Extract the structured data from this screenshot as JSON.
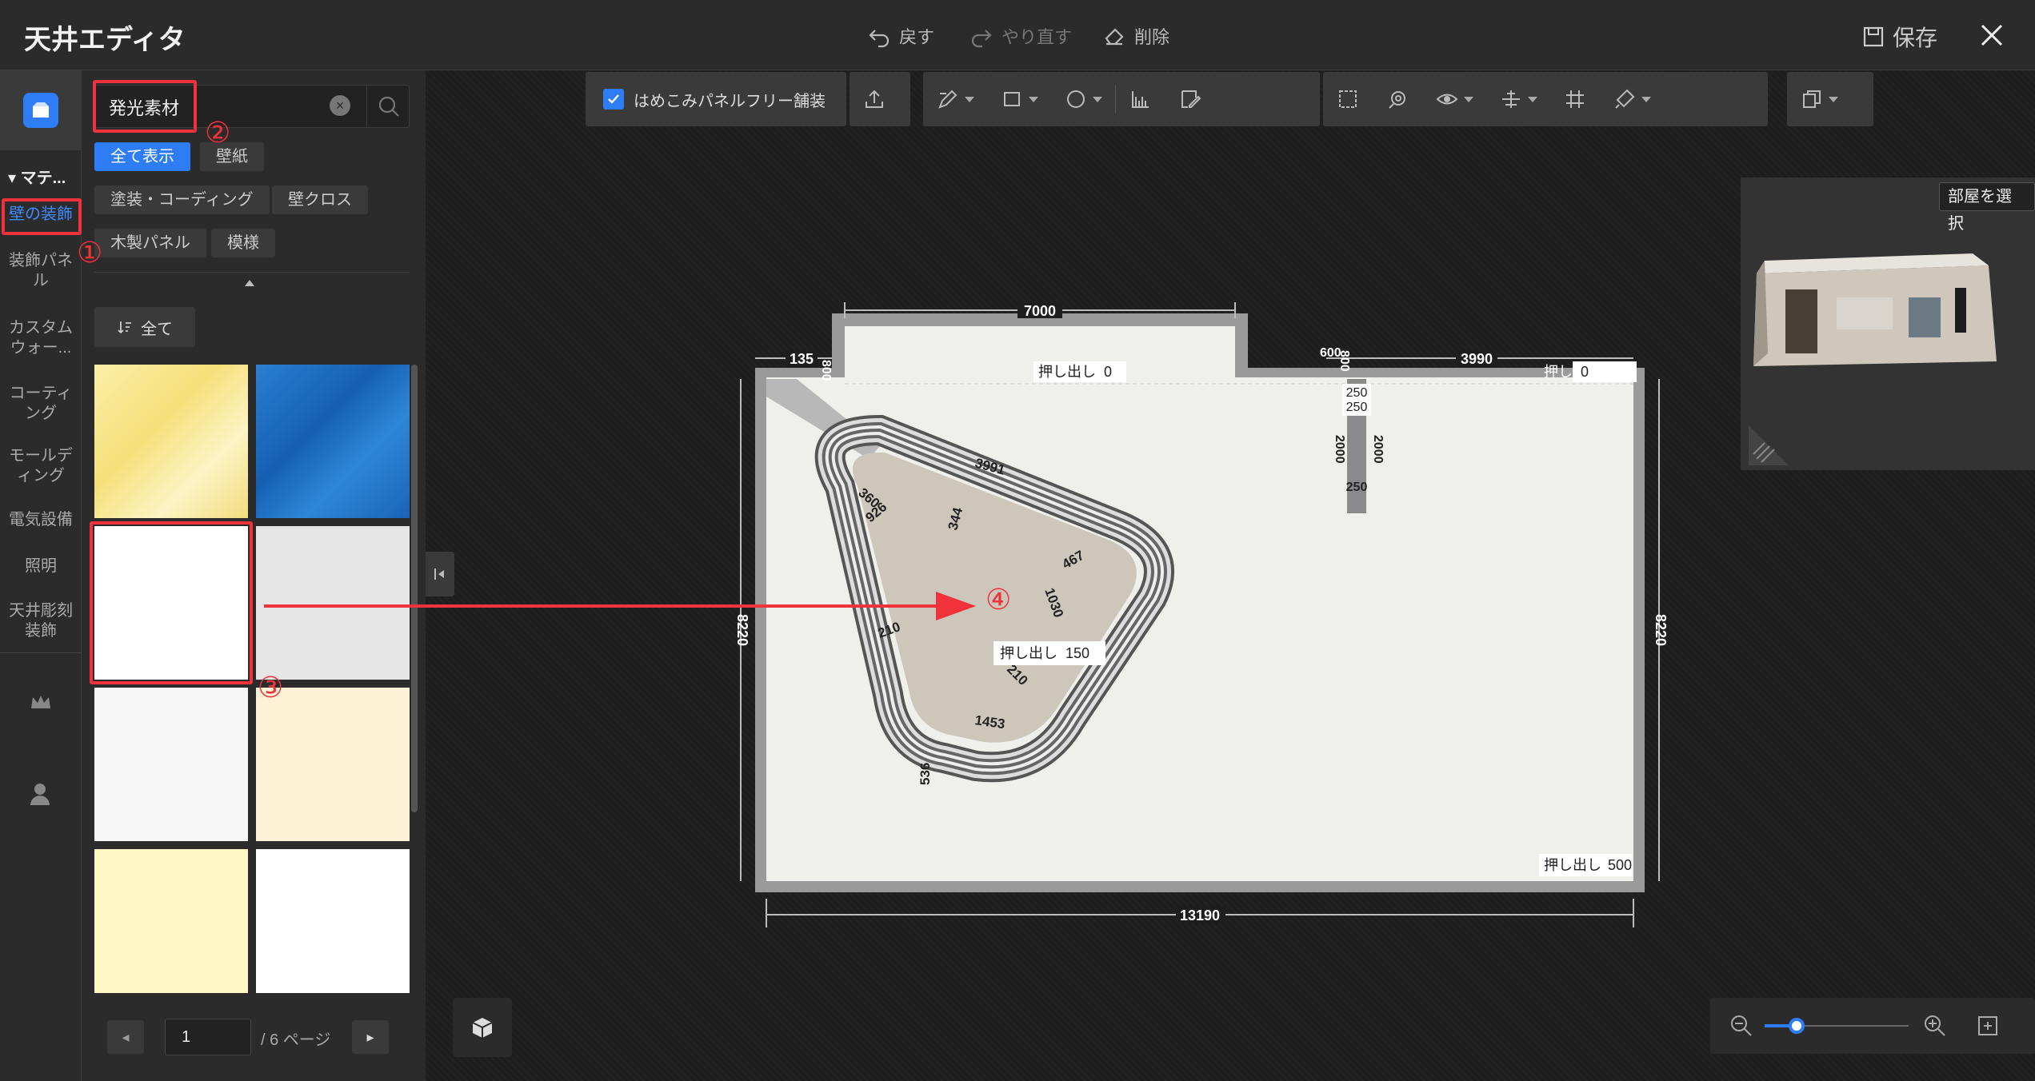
{
  "app": {
    "title": "天井エディタ"
  },
  "topbar": {
    "undo_label": "戻す",
    "redo_label": "やり直す",
    "delete_label": "削除",
    "save_label": "保存"
  },
  "leftnav": {
    "group_label": "マテ...",
    "items": [
      {
        "label": "壁の装飾"
      },
      {
        "label": "装飾パネル"
      },
      {
        "label": "カスタムウォー..."
      },
      {
        "label": "コーティング"
      },
      {
        "label": "モールディング"
      },
      {
        "label": "電気設備"
      },
      {
        "label": "照明"
      },
      {
        "label": "天井彫刻装飾"
      }
    ]
  },
  "panel": {
    "search_value": "発光素材",
    "chips": [
      "全て表示",
      "壁紙",
      "塗装・コーディング",
      "壁クロス",
      "木製パネル",
      "模様"
    ],
    "sort_label": "全て",
    "tiles": [
      {
        "name": "yellow-marble",
        "color": "#f5e28a"
      },
      {
        "name": "blue-marble",
        "color": "#1f6fc6"
      },
      {
        "name": "white",
        "color": "#ffffff"
      },
      {
        "name": "light-gray",
        "color": "#e6e6e6"
      },
      {
        "name": "off-white",
        "color": "#f7f7f7"
      },
      {
        "name": "cream",
        "color": "#fdf1d6"
      },
      {
        "name": "pale-yellow",
        "color": "#fdf8c6"
      },
      {
        "name": "white-2",
        "color": "#ffffff"
      }
    ],
    "pager": {
      "current": "1",
      "total": "/ 6 ページ"
    }
  },
  "toolbar": {
    "checkbox_label": "はめこみパネルフリー舗装"
  },
  "minimap": {
    "select_room_label": "部屋を選択"
  },
  "annotations": {
    "n1": "①",
    "n2": "②",
    "n3": "③",
    "n4": "④"
  },
  "plan": {
    "dims": {
      "top": "7000",
      "top_right": "3990",
      "left_small": "135",
      "v_small": "800",
      "v_small2": "800",
      "c600": "600",
      "c250a": "250",
      "c250b": "250",
      "c250c": "250",
      "c2000a": "2000",
      "c2000b": "2000",
      "left": "8220",
      "right": "8220",
      "bottom": "13190",
      "d360": "360",
      "d926": "926",
      "d3991": "3991",
      "d344": "344",
      "d467": "467",
      "d1030": "1030",
      "d210a": "210",
      "d210b": "210",
      "d1453": "1453",
      "d536": "536"
    },
    "extrude": [
      {
        "label": "押し出し",
        "value": "0"
      },
      {
        "label": "押し出し",
        "value": "0"
      },
      {
        "label": "押し出し",
        "value": "150"
      },
      {
        "label": "押し出し",
        "value": "500"
      }
    ]
  },
  "colors": {
    "accent": "#2f7df6",
    "annotation": "#f0333b"
  }
}
